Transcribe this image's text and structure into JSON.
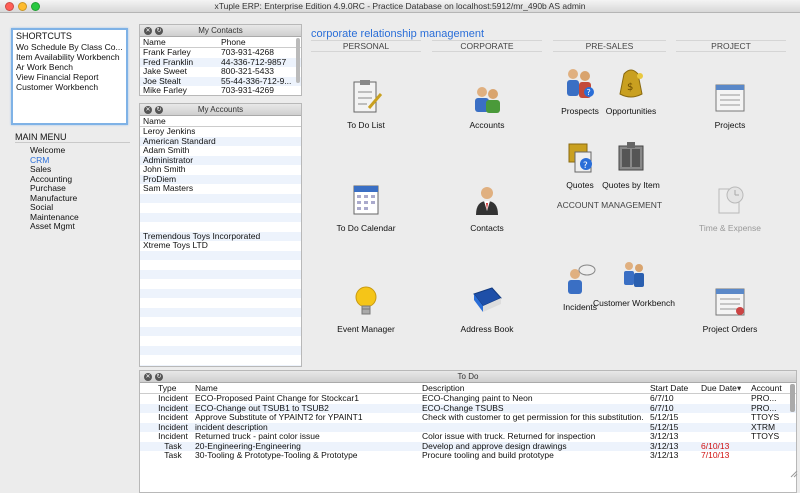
{
  "window": {
    "title": "xTuple ERP: Enterprise Edition 4.9.0RC - Practice Database on localhost:5912/mr_490b AS admin"
  },
  "shortcuts": {
    "header": "SHORTCUTS",
    "items": [
      "Wo Schedule By Class Co...",
      "Item Availability Workbench",
      "Ar Work Bench",
      "View Financial Report",
      "Customer Workbench"
    ]
  },
  "main_menu": {
    "title": "MAIN MENU",
    "items": [
      "Welcome",
      "CRM",
      "Sales",
      "Accounting",
      "Purchase",
      "Manufacture",
      "Social",
      "Maintenance",
      "Asset Mgmt"
    ],
    "selected": "CRM"
  },
  "contacts": {
    "title": "My Contacts",
    "columns": [
      "Name",
      "Phone"
    ],
    "rows": [
      [
        "Frank Farley",
        "703-931-4268"
      ],
      [
        "Fred Franklin",
        "44-336-712-9857"
      ],
      [
        "Jake Sweet",
        "800-321-5433"
      ],
      [
        "Joe Stealt",
        "55-44-336-712-9..."
      ],
      [
        "Mike Farley",
        "703-931-4269"
      ]
    ]
  },
  "accounts": {
    "title": "My Accounts",
    "columns": [
      "Name"
    ],
    "rows": [
      "Leroy Jenkins",
      "American Standard",
      "Adam Smith",
      "Administrator",
      "John Smith",
      "ProDiem",
      "Sam Masters",
      "",
      "",
      "",
      "",
      "Tremendous Toys Incorporated",
      "Xtreme Toys LTD"
    ]
  },
  "crm": {
    "title": "corporate relationship management",
    "sections": {
      "personal": "PERSONAL",
      "corporate": "CORPORATE",
      "presales": "PRE-SALES",
      "project": "PROJECT",
      "account_mgmt": "ACCOUNT MANAGEMENT"
    },
    "tiles": {
      "todo_list": "To Do List",
      "accounts": "Accounts",
      "prospects": "Prospects",
      "opportunities": "Opportunities",
      "projects": "Projects",
      "quotes": "Quotes",
      "quotes_by_item": "Quotes by Item",
      "todo_calendar": "To Do Calendar",
      "contacts": "Contacts",
      "time_expense": "Time & Expense",
      "event_manager": "Event Manager",
      "address_book": "Address Book",
      "incidents": "Incidents",
      "customer_workbench": "Customer Workbench",
      "project_orders": "Project Orders"
    }
  },
  "todo": {
    "title": "To Do",
    "columns": [
      "Type",
      "Name",
      "Description",
      "Start Date",
      "Due Date",
      "Account"
    ],
    "rows": [
      [
        "Incident",
        "ECO-Proposed Paint Change for Stockcar1",
        "ECO-Changing paint to Neon",
        "6/7/10",
        "",
        "PRO..."
      ],
      [
        "Incident",
        "ECO-Change out TSUB1 to TSUB2",
        "ECO-Change TSUBS",
        "6/7/10",
        "",
        "PRO..."
      ],
      [
        "Incident",
        "Approve Substitute of YPAINT2 for YPAINT1",
        "Check with customer to get permission for this substitution.",
        "5/12/15",
        "",
        "TTOYS"
      ],
      [
        "Incident",
        "incident description",
        "",
        "5/12/15",
        "",
        "XTRM"
      ],
      [
        "Incident",
        "Returned truck - paint color issue",
        "Color issue with truck.  Returned for inspection",
        "3/12/13",
        "",
        "TTOYS"
      ],
      [
        "Task",
        "20-Engineering-Engineering",
        "Develop and approve design drawings",
        "3/12/13",
        "6/10/13",
        ""
      ],
      [
        "Task",
        "30-Tooling & Prototype-Tooling & Prototype",
        "Procure tooling and build prototype",
        "3/12/13",
        "7/10/13",
        ""
      ]
    ]
  },
  "colors": {
    "accent": "#2a6ed8",
    "overdue": "#d01010",
    "alt_row": "#edf3fc"
  }
}
